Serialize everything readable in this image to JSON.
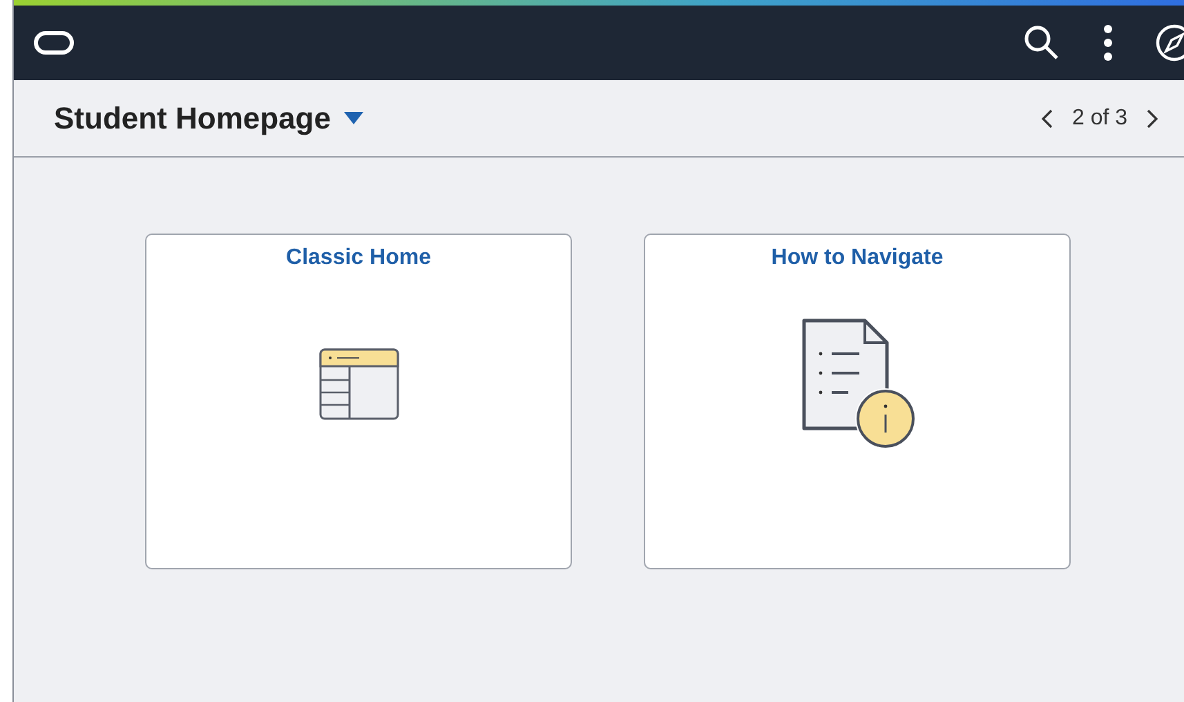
{
  "page_bar": {
    "title": "Student Homepage",
    "pager": "2 of 3"
  },
  "tiles": [
    {
      "title": "Classic Home",
      "kind": "classic"
    },
    {
      "title": "How to Navigate",
      "kind": "document"
    }
  ]
}
